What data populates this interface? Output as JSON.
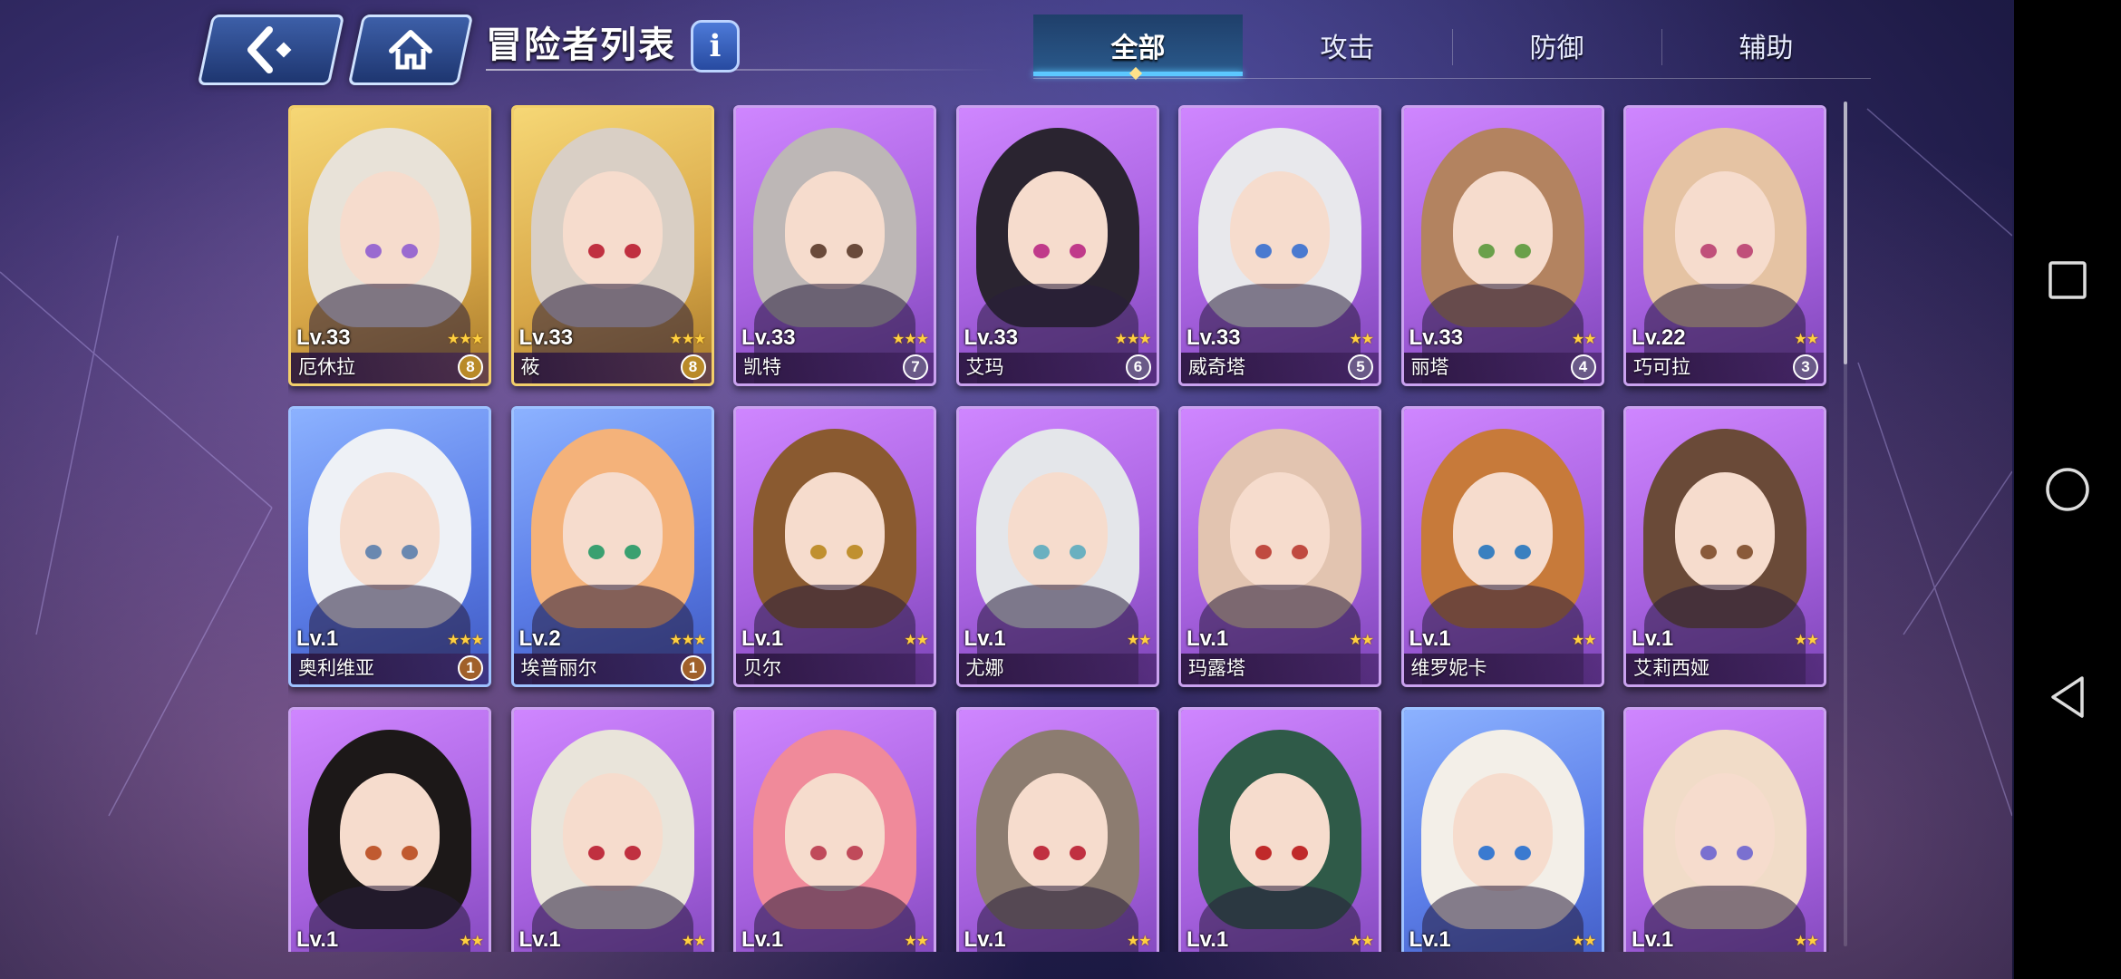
{
  "header": {
    "title": "冒险者列表",
    "info_label": "i"
  },
  "tabs": [
    {
      "label": "全部",
      "active": true
    },
    {
      "label": "攻击",
      "active": false
    },
    {
      "label": "防御",
      "active": false
    },
    {
      "label": "辅助",
      "active": false
    }
  ],
  "cards": [
    {
      "level": "Lv.33",
      "name": "厄休拉",
      "rank": "8",
      "stars": 3,
      "frame": "gold"
    },
    {
      "level": "Lv.33",
      "name": "莜",
      "rank": "8",
      "stars": 3,
      "frame": "gold"
    },
    {
      "level": "Lv.33",
      "name": "凯特",
      "rank": "7",
      "stars": 3,
      "frame": "purple"
    },
    {
      "level": "Lv.33",
      "name": "艾玛",
      "rank": "6",
      "stars": 3,
      "frame": "purple"
    },
    {
      "level": "Lv.33",
      "name": "威奇塔",
      "rank": "5",
      "stars": 2,
      "frame": "purple"
    },
    {
      "level": "Lv.33",
      "name": "丽塔",
      "rank": "4",
      "stars": 2,
      "frame": "purple"
    },
    {
      "level": "Lv.22",
      "name": "巧可拉",
      "rank": "3",
      "stars": 2,
      "frame": "purple"
    },
    {
      "level": "Lv.1",
      "name": "奥利维亚",
      "rank": "1",
      "stars": 3,
      "frame": "blue"
    },
    {
      "level": "Lv.2",
      "name": "埃普丽尔",
      "rank": "1",
      "stars": 3,
      "frame": "blue"
    },
    {
      "level": "Lv.1",
      "name": "贝尔",
      "rank": "",
      "stars": 2,
      "frame": "purple"
    },
    {
      "level": "Lv.1",
      "name": "尤娜",
      "rank": "",
      "stars": 2,
      "frame": "purple"
    },
    {
      "level": "Lv.1",
      "name": "玛露塔",
      "rank": "",
      "stars": 2,
      "frame": "purple"
    },
    {
      "level": "Lv.1",
      "name": "维罗妮卡",
      "rank": "",
      "stars": 2,
      "frame": "purple"
    },
    {
      "level": "Lv.1",
      "name": "艾莉西娅",
      "rank": "",
      "stars": 2,
      "frame": "purple"
    },
    {
      "level": "Lv.1",
      "name": "",
      "rank": "",
      "stars": 2,
      "frame": "purple"
    },
    {
      "level": "Lv.1",
      "name": "",
      "rank": "",
      "stars": 2,
      "frame": "purple"
    },
    {
      "level": "Lv.1",
      "name": "",
      "rank": "",
      "stars": 2,
      "frame": "purple"
    },
    {
      "level": "Lv.1",
      "name": "",
      "rank": "",
      "stars": 2,
      "frame": "purple"
    },
    {
      "level": "Lv.1",
      "name": "",
      "rank": "",
      "stars": 2,
      "frame": "purple"
    },
    {
      "level": "Lv.1",
      "name": "",
      "rank": "",
      "stars": 2,
      "frame": "blue"
    },
    {
      "level": "Lv.1",
      "name": "",
      "rank": "",
      "stars": 2,
      "frame": "purple"
    }
  ],
  "system_nav": {
    "icons": [
      "square-recents-icon",
      "circle-home-icon",
      "triangle-back-icon"
    ]
  }
}
